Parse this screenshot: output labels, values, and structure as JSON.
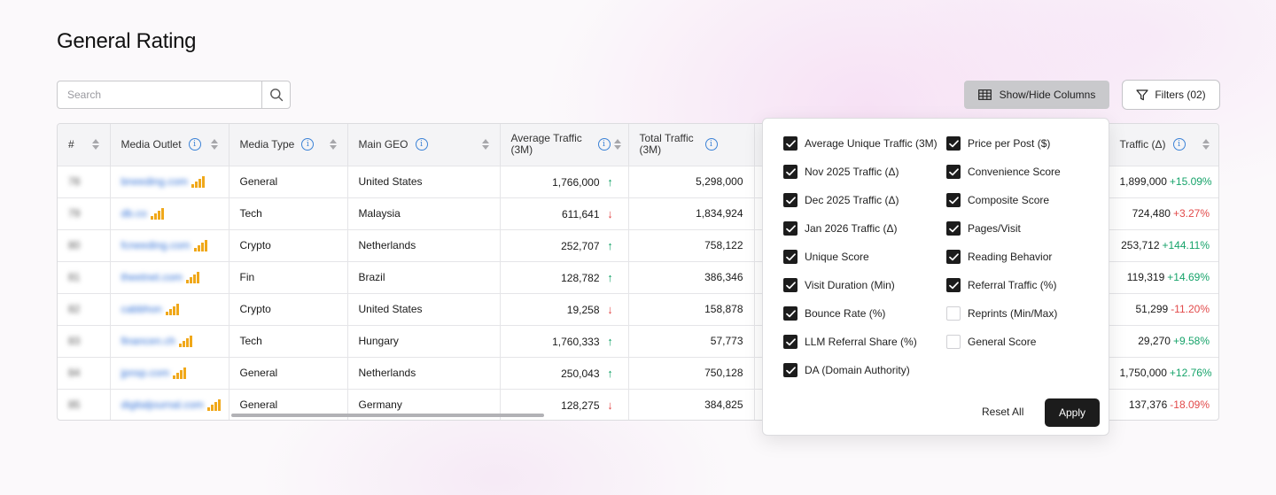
{
  "page": {
    "title": "General Rating"
  },
  "search": {
    "placeholder": "Search"
  },
  "toolbar": {
    "show_hide_label": "Show/Hide Columns",
    "filters_label": "Filters (02)"
  },
  "table": {
    "columns": {
      "num": "#",
      "outlet": "Media Outlet",
      "type": "Media Type",
      "geo": "Main GEO",
      "avg": "Average Traffic (3M)",
      "total": "Total Traffic (3M)",
      "last": "Traffic (Δ)"
    },
    "rows": [
      {
        "rank": "78",
        "outlet": "bneeding.com",
        "type": "General",
        "geo": "United States",
        "avg": "1,766,000",
        "avg_trend": "up",
        "total": "5,298,000",
        "last": "1,899,000",
        "pct": "+15.09%",
        "pct_trend": "up"
      },
      {
        "rank": "79",
        "outlet": "db.co",
        "type": "Tech",
        "geo": "Malaysia",
        "avg": "611,641",
        "avg_trend": "down",
        "total": "1,834,924",
        "last": "724,480",
        "pct": "+3.27%",
        "pct_trend": "down"
      },
      {
        "rank": "80",
        "outlet": "fcneeding.com",
        "type": "Crypto",
        "geo": "Netherlands",
        "avg": "252,707",
        "avg_trend": "up",
        "total": "758,122",
        "last": "253,712",
        "pct": "+144.11%",
        "pct_trend": "up"
      },
      {
        "rank": "81",
        "outlet": "theetnet.com",
        "type": "Fin",
        "geo": "Brazil",
        "avg": "128,782",
        "avg_trend": "up",
        "total": "386,346",
        "last": "119,319",
        "pct": "+14.69%",
        "pct_trend": "up"
      },
      {
        "rank": "82",
        "outlet": "cabbhon",
        "type": "Crypto",
        "geo": "United States",
        "avg": "19,258",
        "avg_trend": "down",
        "total": "158,878",
        "last": "51,299",
        "pct": "-11.20%",
        "pct_trend": "down"
      },
      {
        "rank": "83",
        "outlet": "financen.ch",
        "type": "Tech",
        "geo": "Hungary",
        "avg": "1,760,333",
        "avg_trend": "up",
        "total": "57,773",
        "last": "29,270",
        "pct": "+9.58%",
        "pct_trend": "up"
      },
      {
        "rank": "84",
        "outlet": "jpnsp.com",
        "type": "General",
        "geo": "Netherlands",
        "avg": "250,043",
        "avg_trend": "up",
        "total": "750,128",
        "last": "1,750,000",
        "pct": "+12.76%",
        "pct_trend": "up"
      },
      {
        "rank": "85",
        "outlet": "digitaljournal.com",
        "type": "General",
        "geo": "Germany",
        "avg": "128,275",
        "avg_trend": "down",
        "total": "384,825",
        "last": "137,376",
        "pct": "-18.09%",
        "pct_trend": "down"
      }
    ]
  },
  "column_picker": {
    "left": [
      {
        "label": "Average Unique Traffic (3M)",
        "checked": true
      },
      {
        "label": "Nov 2025 Traffic (Δ)",
        "checked": true
      },
      {
        "label": "Dec 2025 Traffic (Δ)",
        "checked": true
      },
      {
        "label": "Jan 2026 Traffic (Δ)",
        "checked": true
      },
      {
        "label": "Unique Score",
        "checked": true
      },
      {
        "label": "Visit Duration (Min)",
        "checked": true
      },
      {
        "label": "Bounce Rate (%)",
        "checked": true
      },
      {
        "label": "LLM Referral Share (%)",
        "checked": true
      },
      {
        "label": "DA (Domain Authority)",
        "checked": true
      }
    ],
    "right": [
      {
        "label": "Price per Post ($)",
        "checked": true
      },
      {
        "label": "Convenience Score",
        "checked": true
      },
      {
        "label": "Composite Score",
        "checked": true
      },
      {
        "label": "Pages/Visit",
        "checked": true
      },
      {
        "label": "Reading Behavior",
        "checked": true
      },
      {
        "label": "Referral Traffic (%)",
        "checked": true
      },
      {
        "label": "Reprints (Min/Max)",
        "checked": false
      },
      {
        "label": "General Score",
        "checked": false
      }
    ],
    "reset_label": "Reset All",
    "apply_label": "Apply"
  },
  "colors": {
    "accent_dark": "#1c1c1c",
    "up": "#16a36a",
    "down": "#e24a4a",
    "link": "#2f6fd6",
    "signal": "#f0a81a",
    "info": "#3b82d6"
  },
  "icons": {
    "search": "search-icon",
    "table": "table-icon",
    "filter": "filter-icon",
    "info": "info-icon",
    "sort": "sort-icon",
    "signal": "signal-bars-icon",
    "check": "check-icon",
    "arrow_up": "arrow-up-icon",
    "arrow_down": "arrow-down-icon"
  }
}
